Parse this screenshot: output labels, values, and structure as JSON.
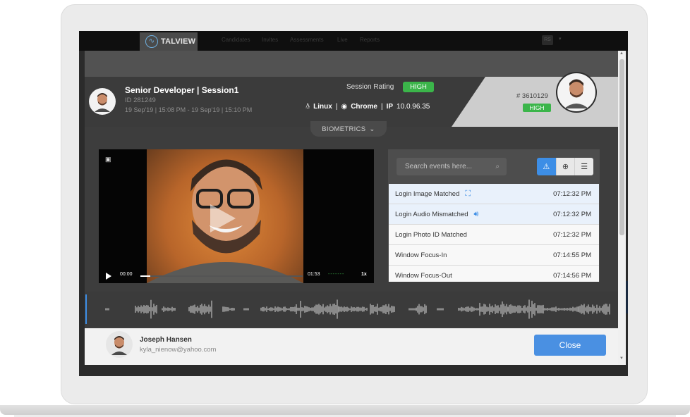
{
  "app": {
    "brand": "TALVIEW",
    "nav": [
      "Candidates",
      "Invites",
      "Assessments",
      "Live",
      "Reports"
    ],
    "user_initials": "RS"
  },
  "session": {
    "title": "Senior Developer | Session1",
    "id_text": "ID 281249",
    "date_range": "19 Sep'19 | 15:08 PM - 19 Sep'19 | 15:10 PM",
    "rating_label": "Session Rating",
    "rating_value": "HIGH",
    "os": "Linux",
    "browser": "Chrome",
    "ip_label": "IP",
    "ip_value": "10.0.96.35",
    "number": "# 3610129",
    "score_badge": "HIGH"
  },
  "biometrics_toggle": "BIOMETRICS",
  "video": {
    "current_time": "00:00",
    "duration": "01:53",
    "speed": "1x",
    "progress": 0.06
  },
  "events": {
    "search_placeholder": "Search events here...",
    "filters": [
      "alert-icon",
      "globe-icon",
      "sliders-icon"
    ],
    "items": [
      {
        "label": "Login Image Matched",
        "time": "07:12:32 PM",
        "icon": "face-scan-icon"
      },
      {
        "label": "Login Audio Mismatched",
        "time": "07:12:32 PM",
        "icon": "speaker-icon"
      },
      {
        "label": "Login Photo ID Matched",
        "time": "07:12:32 PM",
        "icon": ""
      },
      {
        "label": "Window Focus-In",
        "time": "07:14:55 PM",
        "icon": ""
      },
      {
        "label": "Window Focus-Out",
        "time": "07:14:56 PM",
        "icon": ""
      }
    ]
  },
  "candidate": {
    "name": "Joseph Hansen",
    "email": "kyla_nienow@yahoo.com"
  },
  "actions": {
    "close_label": "Close"
  },
  "colors": {
    "accent": "#4a90e2",
    "rating_green": "#3bb54a",
    "dark_bg": "#3d3d3d"
  }
}
